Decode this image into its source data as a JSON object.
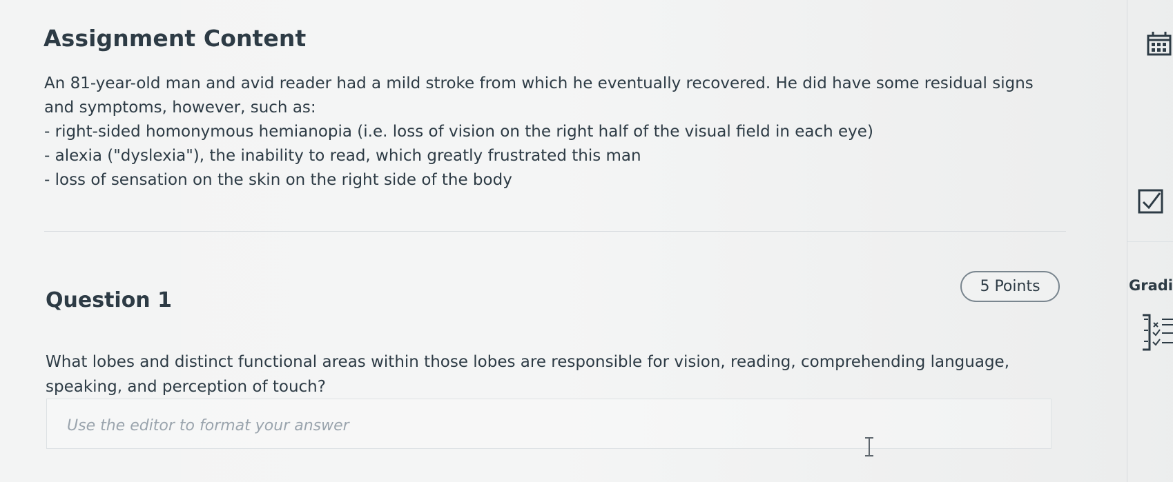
{
  "assignment": {
    "title": "Assignment Content",
    "scenario": [
      "An 81-year-old man and avid reader had a mild stroke from which he eventually recovered. He did have some residual signs and symptoms, however, such as:",
      "- right-sided homonymous hemianopia (i.e. loss of vision on the right half of the visual field in each eye)",
      "- alexia (\"dyslexia\"), the inability to read, which greatly frustrated this man",
      "- loss of sensation on the skin on the right side of the body"
    ]
  },
  "question": {
    "title": "Question 1",
    "points": "5 Points",
    "prompt": "What lobes and distinct functional areas within those lobes are responsible for vision, reading, comprehending language, speaking, and perception of touch?",
    "answer_placeholder": "Use the editor to format your answer"
  },
  "right_rail": {
    "label": "Gradi",
    "icons": [
      "calendar-icon",
      "checkbox-icon",
      "rubric-icon"
    ]
  },
  "colors": {
    "text": "#2d3b45",
    "border": "#7a868f",
    "placeholder": "#9aa4ad",
    "background": "#f3f4f4"
  }
}
